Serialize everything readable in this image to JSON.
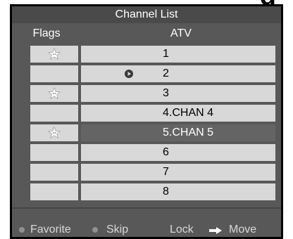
{
  "header_fragment": "g",
  "title": "Channel List",
  "columns": {
    "flags": "Flags",
    "source": "ATV"
  },
  "channels": [
    {
      "name": "1",
      "favorite": true,
      "playing": false,
      "selected": false
    },
    {
      "name": "2",
      "favorite": false,
      "playing": true,
      "selected": false
    },
    {
      "name": "3",
      "favorite": true,
      "playing": false,
      "selected": false
    },
    {
      "name": "4.CHAN 4",
      "favorite": false,
      "playing": false,
      "selected": false
    },
    {
      "name": "5.CHAN 5",
      "favorite": true,
      "playing": false,
      "selected": true
    },
    {
      "name": "6",
      "favorite": false,
      "playing": false,
      "selected": false
    },
    {
      "name": "7",
      "favorite": false,
      "playing": false,
      "selected": false
    },
    {
      "name": "8",
      "favorite": false,
      "playing": false,
      "selected": false
    }
  ],
  "footer": {
    "favorite": "Favorite",
    "skip": "Skip",
    "lock": "Lock",
    "move": "Move"
  },
  "icons": {
    "favorite": "star-icon",
    "playing": "play-icon",
    "favorite_key": "dot-icon",
    "skip_key": "dot-icon",
    "move_key": "arrow-right-icon"
  },
  "colors": {
    "panel": "#585858",
    "title_bar": "#4a4a4a",
    "cell": "#d8d8d8",
    "selected_row": "#646464",
    "footer_dot": "#909090"
  }
}
